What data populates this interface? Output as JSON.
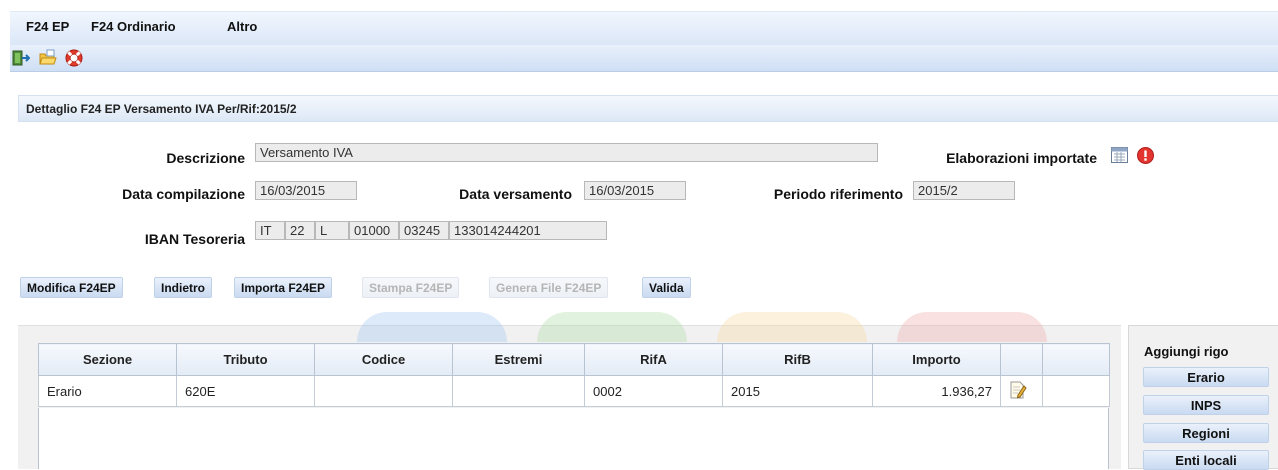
{
  "menu": [
    "F24 EP",
    "F24 Ordinario",
    "Altro"
  ],
  "toolbar": {
    "icons": [
      "exit-icon",
      "open-folder-icon",
      "help-lifebuoy-icon"
    ]
  },
  "panel": {
    "title": "Dettaglio F24 EP Versamento IVA Per/Rif:2015/2"
  },
  "form": {
    "descrizione_label": "Descrizione",
    "descrizione_value": "Versamento IVA",
    "elaborazioni_label": "Elaborazioni importate",
    "data_compilazione_label": "Data compilazione",
    "data_compilazione_value": "16/03/2015",
    "data_versamento_label": "Data versamento",
    "data_versamento_value": "16/03/2015",
    "periodo_label": "Periodo riferimento",
    "periodo_value": "2015/2",
    "iban_label": "IBAN Tesoreria",
    "iban_parts": [
      "IT",
      "22",
      "L",
      "01000",
      "03245",
      "133014244201"
    ]
  },
  "actions": {
    "modifica": "Modifica F24EP",
    "indietro": "Indietro",
    "importa": "Importa F24EP",
    "stampa": "Stampa F24EP",
    "genera": "Genera File F24EP",
    "valida": "Valida"
  },
  "grid": {
    "columns": [
      "Sezione",
      "Tributo",
      "Codice",
      "Estremi",
      "RifA",
      "RifB",
      "Importo",
      "",
      ""
    ],
    "rows": [
      {
        "sezione": "Erario",
        "tributo": "620E",
        "codice": "",
        "estremi": "",
        "rifa": "0002",
        "rifb": "2015",
        "importo": "1.936,27"
      }
    ]
  },
  "side": {
    "title": "Aggiungi rigo",
    "buttons": [
      "Erario",
      "INPS",
      "Regioni",
      "Enti locali"
    ]
  }
}
